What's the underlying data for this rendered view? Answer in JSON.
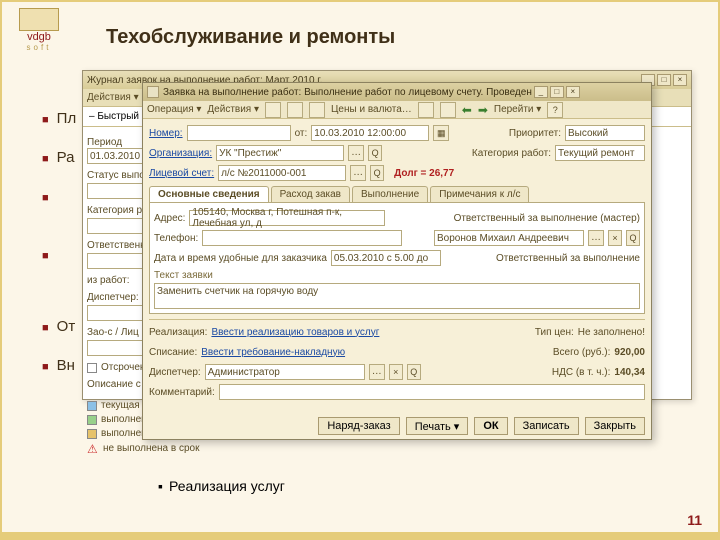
{
  "slide": {
    "title": "Техобслуживание и ремонты",
    "logo_text": "vdgb",
    "logo_sub": "soft",
    "page": "11",
    "bullets": {
      "b1": "Пл",
      "b2": "Ра",
      "b3": "От",
      "b4": "Вн",
      "svc": "Реализация услуг"
    }
  },
  "journal": {
    "title": "Журнал заявок на выполнение работ: Март 2010 г.",
    "action": "Действия ▾",
    "filter_label": "– Быстрый от",
    "period_label": "Период",
    "period_from": "01.03.2010",
    "status_label": "Статус выпол",
    "cat_label": "Категория раб",
    "resp_label": "Ответственн",
    "iz_label": "из работ:",
    "disp_label": "Диспетчер:",
    "zao_label": "Зао-с / Лиц",
    "otrec_label": "Отсрочен",
    "desc_label": "Описание с",
    "leg1": "текущая с",
    "leg2": "выполнен",
    "leg3": "выполнен",
    "leg4": "не выполнена в срок"
  },
  "req": {
    "title": "Заявка на выполнение работ: Выполнение работ по лицевому счету. Проведен",
    "tb_op": "Операция ▾",
    "tb_act": "Действия ▾",
    "tb_price": "Цены и валюта…",
    "tb_go": "Перейти ▾",
    "num_label": "Номер:",
    "from_label": "от:",
    "date": "10.03.2010 12:00:00",
    "prio_label": "Приоритет:",
    "prio_val": "Высокий",
    "org_label": "Организация:",
    "org_val": "УК \"Престиж\"",
    "cat_label": "Категория работ:",
    "cat_val": "Текущий ремонт",
    "ls_label": "Лицевой счет:",
    "ls_val": "л/с №2011000-001",
    "ls_size_label": "Расход закав",
    "dolg": "Долг = 26,77",
    "tabs": {
      "t1": "Основные сведения",
      "t2": "Расход закав",
      "t3": "Выполнение",
      "t4": "Примечания к л/с"
    },
    "addr_label": "Адрес:",
    "addr_val": "105140, Москва г, Потешная п-к, Лечебная ул, д",
    "resp_label": "Ответственный за выполнение (мастер)",
    "resp_val": "Воронов Михаил Андреевич",
    "phone_label": "Телефон:",
    "time_label": "Дата и время удобные для заказчика",
    "time_val": "05.03.2010  с 5.00 до",
    "resp_short": "Ответственный за выполнение",
    "text_label": "Текст заявки",
    "text_val": "Заменить счетчик на горячую воду",
    "real_label": "Реализация:",
    "real_cmd": "Ввести реализацию товаров и услуг",
    "tip_label": "Тип цен:",
    "tip_val": "Не заполнено!",
    "spis_label": "Списание:",
    "spis_cmd": "Ввести требование-накладную",
    "sum_label": "Всего (руб.):",
    "sum_val": "920,00",
    "disp_label": "Диспетчер:",
    "disp_val": "Администратор",
    "nds_label": "НДС (в т. ч.):",
    "nds_val": "140,34",
    "comm_label": "Комментарий:",
    "btn_naryad": "Наряд-заказ",
    "btn_print": "Печать ▾",
    "btn_ok": "ОК",
    "btn_save": "Записать",
    "btn_close": "Закрыть"
  }
}
